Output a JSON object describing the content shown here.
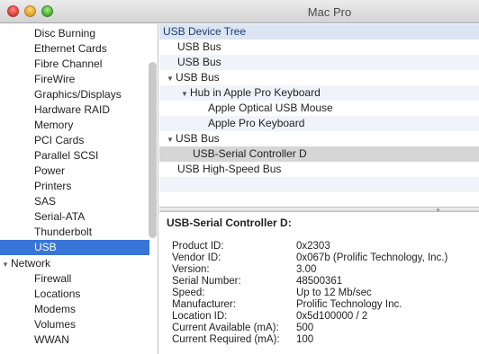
{
  "window": {
    "title": "Mac Pro"
  },
  "sidebar": {
    "items": [
      {
        "label": "Disc Burning"
      },
      {
        "label": "Ethernet Cards"
      },
      {
        "label": "Fibre Channel"
      },
      {
        "label": "FireWire"
      },
      {
        "label": "Graphics/Displays"
      },
      {
        "label": "Hardware RAID"
      },
      {
        "label": "Memory"
      },
      {
        "label": "PCI Cards"
      },
      {
        "label": "Parallel SCSI"
      },
      {
        "label": "Power"
      },
      {
        "label": "Printers"
      },
      {
        "label": "SAS"
      },
      {
        "label": "Serial-ATA"
      },
      {
        "label": "Thunderbolt"
      },
      {
        "label": "USB"
      },
      {
        "label": "Network"
      },
      {
        "label": "Firewall"
      },
      {
        "label": "Locations"
      },
      {
        "label": "Modems"
      },
      {
        "label": "Volumes"
      },
      {
        "label": "WWAN"
      }
    ],
    "selected": "USB"
  },
  "tree": {
    "header": "USB Device Tree",
    "rows": [
      {
        "label": "USB Bus"
      },
      {
        "label": "USB Bus"
      },
      {
        "label": "USB Bus"
      },
      {
        "label": "Hub in Apple Pro Keyboard"
      },
      {
        "label": "Apple Optical USB Mouse"
      },
      {
        "label": "Apple Pro Keyboard"
      },
      {
        "label": "USB Bus"
      },
      {
        "label": "USB-Serial Controller D"
      },
      {
        "label": "USB High-Speed Bus"
      }
    ]
  },
  "detail": {
    "title": "USB-Serial Controller D:",
    "properties": [
      {
        "key": "Product ID:",
        "value": "0x2303"
      },
      {
        "key": "Vendor ID:",
        "value": "0x067b  (Prolific Technology, Inc.)"
      },
      {
        "key": "Version:",
        "value": "3.00"
      },
      {
        "key": "Serial Number:",
        "value": "48500361"
      },
      {
        "key": "Speed:",
        "value": "Up to 12 Mb/sec"
      },
      {
        "key": "Manufacturer:",
        "value": "Prolific Technology Inc."
      },
      {
        "key": "Location ID:",
        "value": "0x5d100000 / 2"
      },
      {
        "key": "Current Available (mA):",
        "value": "500"
      },
      {
        "key": "Current Required (mA):",
        "value": "100"
      }
    ]
  }
}
